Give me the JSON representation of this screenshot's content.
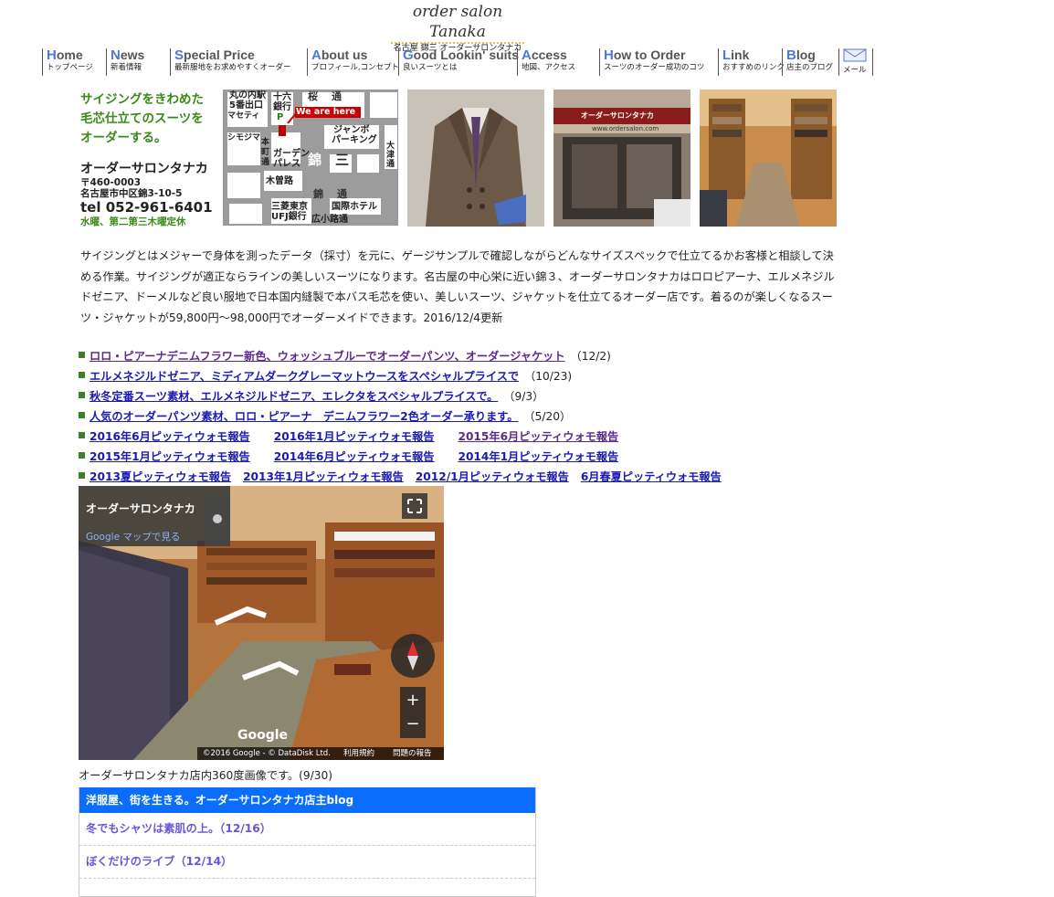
{
  "logo": {
    "script": "order salon Tanaka",
    "sub": "名古屋 錦三 オーダーサロンタナカ"
  },
  "nav": [
    {
      "cap": "H",
      "rest": "ome",
      "sub": "トップページ",
      "w": 70
    },
    {
      "cap": "N",
      "rest": "ews",
      "sub": "新着情報",
      "w": 70
    },
    {
      "cap": "S",
      "rest": "pecial Price",
      "sub": "最新服地をお求めやすくオーダー",
      "w": 150
    },
    {
      "cap": "A",
      "rest": "bout us",
      "sub": "プロフィール,コンセプト",
      "w": 100
    },
    {
      "cap": "G",
      "rest": "ood Lookin' suits",
      "sub": "良いスーツとは",
      "w": 130
    },
    {
      "cap": "A",
      "rest": "ccess",
      "sub": "地図、アクセス",
      "w": 90
    },
    {
      "cap": "H",
      "rest": "ow to Order",
      "sub": "スーツのオーダー成功のコツ",
      "w": 130
    },
    {
      "cap": "L",
      "rest": "ink",
      "sub": "おすすめのリンク",
      "w": 70
    },
    {
      "cap": "B",
      "rest": "log",
      "sub": "店主のブログ",
      "w": 62
    },
    {
      "cap": "",
      "rest": "",
      "sub": "メール",
      "w": 38
    }
  ],
  "intro": {
    "tagline": [
      "サイジングをきわめた",
      "毛芯仕立てのスーツを",
      "オーダーする。"
    ],
    "shop_name": "オーダーサロンタナカ",
    "zip": "〒460-0003",
    "address": "名古屋市中区錦3-10-5",
    "tel": "tel 052-961-6401",
    "closed": "水曜、第二第三木曜定休"
  },
  "map": {
    "labels": {
      "marunouchi": "丸の内駅",
      "exit5": "5番出口",
      "macetti": "マセティ",
      "juroku": "十六",
      "ginko": "銀行",
      "sakura": "桜",
      "dori1": "通",
      "p": "P",
      "we_are_here": "We are here",
      "shimojima": "シモジマ",
      "hon": "本",
      "machi": "町",
      "dori2": "通",
      "jumbo": "ジャンボ",
      "parking": "パーキング",
      "ootsu": "大",
      "ootsu2": "津",
      "ootsu3": "通",
      "garden": "ガーデン",
      "palace": "パレス",
      "nishiki": "錦",
      "san": "三",
      "kisoji": "木曽路",
      "nishiki_dori": "錦",
      "nishiki_dori2": "通",
      "mitsubishi": "三菱東京",
      "ufj": "UFJ銀行",
      "kokusai": "国際ホテル",
      "hirokoji": "広小路通"
    }
  },
  "photos": {
    "shop_sign": "オーダーサロンタナカ",
    "url_sign": "www.ordersalon.com"
  },
  "description": "サイジングとはメジャーで身体を測ったデータ（採寸）を元に、ゲージサンプルで確認しながらどんなサイズスペックで仕立てるかお客様と相談して決める作業。サイジングが適正ならラインの美しいスーツになります。名古屋の中心栄に近い錦３、オーダーサロンタナカはロロピアーナ、エルメネジルドゼニア、ドーメルなど良い服地で日本国内縫製で本バス毛芯を使い、美しいスーツ、ジャケットを仕立てるオーダー店です。着るのが楽しくなるスーツ・ジャケットが59,800円〜98,000円でオーダーメイドできます。2016/12/4更新",
  "news": [
    {
      "links": [
        {
          "text": "ロロ・ピアーナデニムフラワー新色、ウォッシュブルーでオーダーパンツ、オーダージャケット",
          "visited": true
        }
      ],
      "date": "（12/2)"
    },
    {
      "links": [
        {
          "text": "エルメネジルドゼニア、ミディアムダークグレーマットウースをスペシャルプライスで",
          "visited": false
        }
      ],
      "date": "（10/23)"
    },
    {
      "links": [
        {
          "text": "秋冬定番スーツ素材、エルメネジルドゼニア、エレクタをスペシャルプライスで。",
          "visited": false
        }
      ],
      "date": "（9/3）"
    },
    {
      "links": [
        {
          "text": "人気のオーダーパンツ素材、ロロ・ピアーナ　デニムフラワー2色オーダー承ります。",
          "visited": false
        }
      ],
      "date": "（5/20）"
    },
    {
      "links": [
        {
          "text": "2016年6月ピッティウォモ報告",
          "visited": false
        },
        {
          "text": "2016年1月ピッティウォモ報告",
          "visited": false
        },
        {
          "text": "2015年6月ピッティウォモ報告",
          "visited": true
        }
      ],
      "date": ""
    },
    {
      "links": [
        {
          "text": "2015年1月ピッティウォモ報告",
          "visited": false
        },
        {
          "text": "2014年6月ピッティウォモ報告",
          "visited": false
        },
        {
          "text": "2014年1月ピッティウォモ報告",
          "visited": false
        }
      ],
      "date": ""
    },
    {
      "links": [
        {
          "text": "2013夏ピッティウォモ報告",
          "visited": false
        },
        {
          "text": "2013年1月ピッティウォモ報告",
          "visited": false
        },
        {
          "text": "2012/1月ピッティウォモ報告",
          "visited": false
        },
        {
          "text": "6月春夏ピッティウォモ報告",
          "visited": false
        }
      ],
      "date": ""
    }
  ],
  "streetview": {
    "place_name": "オーダーサロンタナカ",
    "view_in_maps": "Google マップで見る",
    "google": "Google",
    "copyright": "©2016 Google - © DataDisk Ltd.",
    "terms": "利用規約",
    "report": "問題の報告",
    "zoom_in": "+",
    "zoom_out": "−"
  },
  "streetview_caption": "オーダーサロンタナカ店内360度画像です。(9/30)",
  "blog": {
    "header": "洋服屋、街を生きる。オーダーサロンタナカ店主blog",
    "items": [
      "冬でもシャツは素肌の上。（12/16）",
      "ぼくだけのライブ（12/14）"
    ]
  }
}
